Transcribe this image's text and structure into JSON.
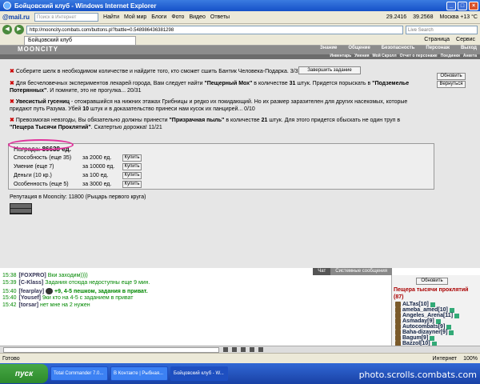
{
  "window": {
    "title": "Бойцовский клуб - Windows Internet Explorer"
  },
  "mailbar": {
    "logo": "@mail.ru",
    "search_placeholder": "Поиск в Интернет",
    "find": "Найти",
    "items": [
      "Мой мир",
      "Блоги",
      "Фото",
      "Видео",
      "Ответы"
    ],
    "rate1": "29.2416",
    "rate2": "39.2568",
    "weather": "Москва +13 °C"
  },
  "address": {
    "url": "http://mooncity.combats.com/buttons.pl?battle=0.548986436381298"
  },
  "tab": {
    "label": "Бойцовский клуб",
    "cmds": [
      "Страница",
      "Сервис"
    ]
  },
  "game": {
    "brand": "MOONCITY",
    "menu1": [
      "Знание",
      "Общение",
      "Безопасность",
      "Персонаж",
      "Выход"
    ],
    "menu2": [
      "Инвентарь",
      "Умения",
      "Мой Скролл",
      "Отчет о персонаже",
      "Поединки",
      "Анкета"
    ],
    "btn_refresh": "Обновить",
    "btn_return": "Вернуться",
    "q1": "Соберите шелк в необходимом количестве и найдите того, кто сможет сшить Бантик Человека-Подарка. 3/3",
    "btn_complete": "Завершить задание",
    "q2a": "Для бесчеловечных экспериментов лекарей города, Вам следует найти ",
    "q2b": "\"Пещерный Мох\"",
    "q2c": " в количестве ",
    "q2d": "31",
    "q2e": " штук. Придется порыскать в ",
    "q2f": "\"Подземелье Потерянных\"",
    "q2g": ". И помните, это не прогулка... 20/31",
    "q3a": "Увесистый гусениц",
    "q3b": " - отожравшийся на нижних этажах Грибницы и редко их покидающий. Но их размер заразителен для других насекомых, которые придают путь Разума. Убей ",
    "q3c": "10",
    "q3d": " штук и в доказательство принеси нам кусок их панцирей... 0/10",
    "q4a": "Превозмогая невзгоды, Вы обязательно должны принести ",
    "q4b": "\"Призрачная пыль\"",
    "q4c": " в количестве ",
    "q4d": "21",
    "q4e": " штук. Для этого придется обыскать не один труп в ",
    "q4f": "\"Пещера Тысячи Проклятий\"",
    "q4g": ". Скатертью дорожка! 11/21",
    "reward_label": "Награда: ",
    "reward_value": "86638 ед.",
    "rows": [
      {
        "name": "Способность (еще 35)",
        "cost": "за 2000 ед.",
        "btn": "Купить"
      },
      {
        "name": "Умение (еще 7)",
        "cost": "за 10000 ед.",
        "btn": "Купить"
      },
      {
        "name": "Деньги (10 кр.)",
        "cost": "за 100 ед.",
        "btn": "Купить"
      },
      {
        "name": "Особенность (еще 5)",
        "cost": "за 3000 ед.",
        "btn": "Купить"
      }
    ],
    "reputation": "Репутация в Mooncity: 11800 (Рыцарь первого круга)"
  },
  "chat": {
    "tab_chat": "Чат",
    "tab_sys": "Системные сообщения",
    "lines": [
      {
        "time": "15:38",
        "nick": "[FOXPRO]",
        "text": "Вки заходим))))"
      },
      {
        "time": "15:39",
        "nick": "[C-Klass]",
        "text": "Задания отсюда недоступны еще 9 мин."
      },
      {
        "time": "15:40",
        "nick": "[fearplay]",
        "text": "+9, 4-5 пешком, задания в приват."
      },
      {
        "time": "15:40",
        "nick": "[Yousef]",
        "text": "9ки кто на 4-5 с заданием в приват"
      },
      {
        "time": "15:42",
        "nick": "[torsar]",
        "text": "нет мне на 2 нужен"
      }
    ],
    "refresh": "Обновить",
    "location": "Пещера тысячи проклятий",
    "count": "(87)",
    "players": [
      "ALTas[10]",
      "ameba_amed[10]",
      "Angeles_Arena[11]",
      "Asmaday[9]",
      "Autocombats[9]",
      "Baha-dizayner[9]",
      "Bagum[9]",
      "Bazzol[10]"
    ]
  },
  "status": {
    "left": "Готово",
    "right": [
      "Интернет",
      "100%"
    ]
  },
  "taskbar": {
    "start": "пуск",
    "tasks": [
      "Total Commander 7.0...",
      "В Контакте | Рыбная...",
      "Бойцовский клуб - W..."
    ],
    "watermark": "photo.scrolls.combats.com"
  }
}
